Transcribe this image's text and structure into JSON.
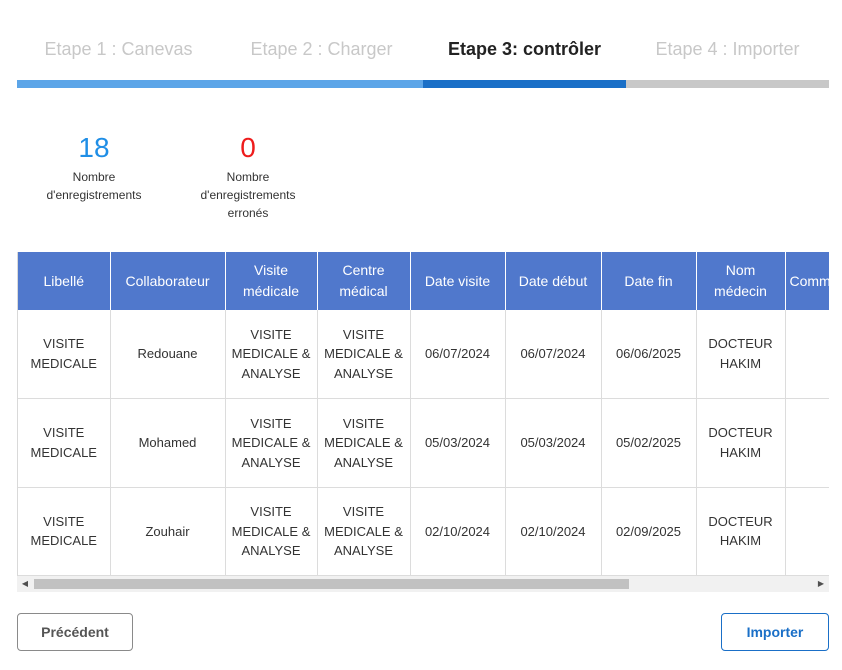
{
  "steps": [
    {
      "label": "Etape 1 : Canevas",
      "state": "done"
    },
    {
      "label": "Etape 2 : Charger",
      "state": "done"
    },
    {
      "label": "Etape 3: contrôler",
      "state": "active"
    },
    {
      "label": "Etape 4 : Importer",
      "state": "pending"
    }
  ],
  "step_colors": {
    "done": "#5ca5e8",
    "active": "#1a6fc7",
    "pending": "#c8c8c8"
  },
  "counters": {
    "total": {
      "value": "18",
      "label": "Nombre d'enregistrements",
      "color": "#1f8ee6"
    },
    "errors": {
      "value": "0",
      "label": "Nombre d'enregistrements erronés",
      "color": "#ee1c1c"
    }
  },
  "table": {
    "header_color": "#5078cc",
    "columns": [
      "Libellé",
      "Collaborateur",
      "Visite médicale",
      "Centre médical",
      "Date visite",
      "Date début",
      "Date fin",
      "Nom médecin",
      "Commentaire"
    ],
    "rows": [
      [
        "VISITE MEDICALE",
        "Redouane",
        "VISITE MEDICALE & ANALYSE",
        "VISITE MEDICALE & ANALYSE",
        "06/07/2024",
        "06/07/2024",
        "06/06/2025",
        "DOCTEUR HAKIM",
        ""
      ],
      [
        "VISITE MEDICALE",
        "Mohamed",
        "VISITE MEDICALE & ANALYSE",
        "VISITE MEDICALE & ANALYSE",
        "05/03/2024",
        "05/03/2024",
        "05/02/2025",
        "DOCTEUR HAKIM",
        ""
      ],
      [
        "VISITE MEDICALE",
        "Zouhair",
        "VISITE MEDICALE & ANALYSE",
        "VISITE MEDICALE & ANALYSE",
        "02/10/2024",
        "02/10/2024",
        "02/09/2025",
        "DOCTEUR HAKIM",
        ""
      ]
    ]
  },
  "scrollbar": {
    "left_icon": "scroll-left-arrow",
    "right_icon": "scroll-right-arrow"
  },
  "buttons": {
    "previous": "Précédent",
    "import": "Importer"
  }
}
